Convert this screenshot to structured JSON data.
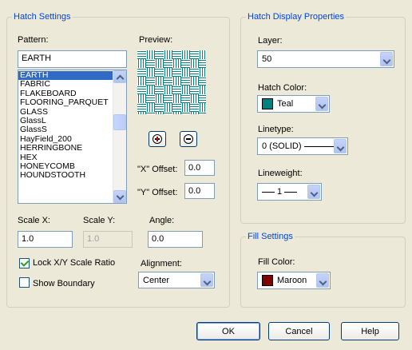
{
  "hatch_settings": {
    "legend": "Hatch Settings",
    "pattern_label": "Pattern:",
    "pattern_value": "EARTH",
    "preview_label": "Preview:",
    "patterns": [
      "EARTH",
      "FABRIC",
      "FLAKEBOARD",
      "FLOORING_PARQUET",
      "GLASS",
      "GlassL",
      "GlassS",
      "HayField_200",
      "HERRINGBONE",
      "HEX",
      "HONEYCOMB",
      "HOUNDSTOOTH"
    ],
    "selected_pattern": "EARTH",
    "x_offset_label": "\"X\" Offset:",
    "x_offset": "0.0",
    "y_offset_label": "\"Y\" Offset:",
    "y_offset": "0.0",
    "scale_x_label": "Scale X:",
    "scale_x": "1.0",
    "scale_y_label": "Scale Y:",
    "scale_y": "1.0",
    "angle_label": "Angle:",
    "angle": "0.0",
    "lock_ratio_label": "Lock X/Y Scale Ratio",
    "lock_ratio_checked": true,
    "show_boundary_label": "Show Boundary",
    "show_boundary_checked": false,
    "alignment_label": "Alignment:",
    "alignment": "Center"
  },
  "display_props": {
    "legend": "Hatch Display Properties",
    "layer_label": "Layer:",
    "layer": "50",
    "hatch_color_label": "Hatch Color:",
    "hatch_color": "Teal",
    "hatch_color_hex": "#008080",
    "linetype_label": "Linetype:",
    "linetype": "0 (SOLID)",
    "lineweight_label": "Lineweight:",
    "lineweight": "1"
  },
  "fill_settings": {
    "legend": "Fill Settings",
    "fill_color_label": "Fill Color:",
    "fill_color": "Maroon",
    "fill_color_hex": "#800000"
  },
  "buttons": {
    "ok": "OK",
    "cancel": "Cancel",
    "help": "Help"
  },
  "colors": {
    "group_title": "#0046d5",
    "selection": "#316ac5",
    "preview_pattern": "#008080"
  }
}
